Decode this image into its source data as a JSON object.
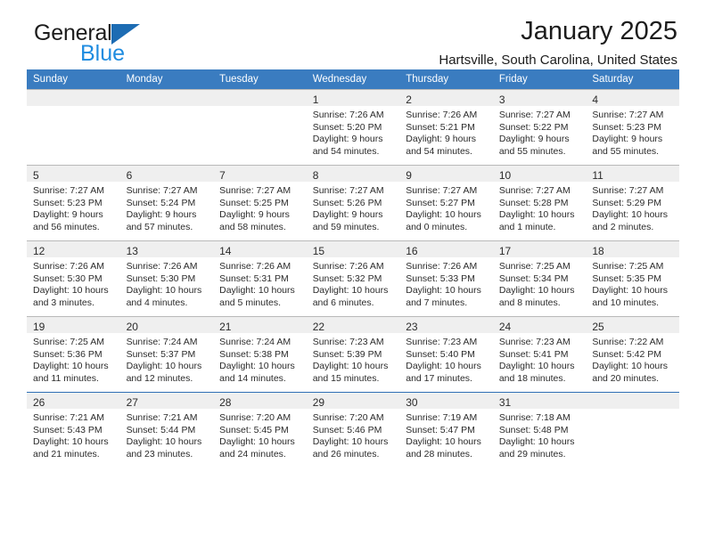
{
  "brand": {
    "name_top": "General",
    "name_bottom": "Blue",
    "accent_color": "#1f8ce0",
    "triangle_color": "#1d6cb3"
  },
  "header": {
    "title": "January 2025",
    "subtitle": "Hartsville, South Carolina, United States"
  },
  "calendar": {
    "header_bg": "#3a7cc0",
    "daynum_bg": "#efefef",
    "weekday_headers": [
      "Sunday",
      "Monday",
      "Tuesday",
      "Wednesday",
      "Thursday",
      "Friday",
      "Saturday"
    ],
    "weeks": [
      [
        {
          "day": "",
          "lines": []
        },
        {
          "day": "",
          "lines": []
        },
        {
          "day": "",
          "lines": []
        },
        {
          "day": "1",
          "lines": [
            "Sunrise: 7:26 AM",
            "Sunset: 5:20 PM",
            "Daylight: 9 hours",
            "and 54 minutes."
          ]
        },
        {
          "day": "2",
          "lines": [
            "Sunrise: 7:26 AM",
            "Sunset: 5:21 PM",
            "Daylight: 9 hours",
            "and 54 minutes."
          ]
        },
        {
          "day": "3",
          "lines": [
            "Sunrise: 7:27 AM",
            "Sunset: 5:22 PM",
            "Daylight: 9 hours",
            "and 55 minutes."
          ]
        },
        {
          "day": "4",
          "lines": [
            "Sunrise: 7:27 AM",
            "Sunset: 5:23 PM",
            "Daylight: 9 hours",
            "and 55 minutes."
          ]
        }
      ],
      [
        {
          "day": "5",
          "lines": [
            "Sunrise: 7:27 AM",
            "Sunset: 5:23 PM",
            "Daylight: 9 hours",
            "and 56 minutes."
          ]
        },
        {
          "day": "6",
          "lines": [
            "Sunrise: 7:27 AM",
            "Sunset: 5:24 PM",
            "Daylight: 9 hours",
            "and 57 minutes."
          ]
        },
        {
          "day": "7",
          "lines": [
            "Sunrise: 7:27 AM",
            "Sunset: 5:25 PM",
            "Daylight: 9 hours",
            "and 58 minutes."
          ]
        },
        {
          "day": "8",
          "lines": [
            "Sunrise: 7:27 AM",
            "Sunset: 5:26 PM",
            "Daylight: 9 hours",
            "and 59 minutes."
          ]
        },
        {
          "day": "9",
          "lines": [
            "Sunrise: 7:27 AM",
            "Sunset: 5:27 PM",
            "Daylight: 10 hours",
            "and 0 minutes."
          ]
        },
        {
          "day": "10",
          "lines": [
            "Sunrise: 7:27 AM",
            "Sunset: 5:28 PM",
            "Daylight: 10 hours",
            "and 1 minute."
          ]
        },
        {
          "day": "11",
          "lines": [
            "Sunrise: 7:27 AM",
            "Sunset: 5:29 PM",
            "Daylight: 10 hours",
            "and 2 minutes."
          ]
        }
      ],
      [
        {
          "day": "12",
          "lines": [
            "Sunrise: 7:26 AM",
            "Sunset: 5:30 PM",
            "Daylight: 10 hours",
            "and 3 minutes."
          ]
        },
        {
          "day": "13",
          "lines": [
            "Sunrise: 7:26 AM",
            "Sunset: 5:30 PM",
            "Daylight: 10 hours",
            "and 4 minutes."
          ]
        },
        {
          "day": "14",
          "lines": [
            "Sunrise: 7:26 AM",
            "Sunset: 5:31 PM",
            "Daylight: 10 hours",
            "and 5 minutes."
          ]
        },
        {
          "day": "15",
          "lines": [
            "Sunrise: 7:26 AM",
            "Sunset: 5:32 PM",
            "Daylight: 10 hours",
            "and 6 minutes."
          ]
        },
        {
          "day": "16",
          "lines": [
            "Sunrise: 7:26 AM",
            "Sunset: 5:33 PM",
            "Daylight: 10 hours",
            "and 7 minutes."
          ]
        },
        {
          "day": "17",
          "lines": [
            "Sunrise: 7:25 AM",
            "Sunset: 5:34 PM",
            "Daylight: 10 hours",
            "and 8 minutes."
          ]
        },
        {
          "day": "18",
          "lines": [
            "Sunrise: 7:25 AM",
            "Sunset: 5:35 PM",
            "Daylight: 10 hours",
            "and 10 minutes."
          ]
        }
      ],
      [
        {
          "day": "19",
          "lines": [
            "Sunrise: 7:25 AM",
            "Sunset: 5:36 PM",
            "Daylight: 10 hours",
            "and 11 minutes."
          ]
        },
        {
          "day": "20",
          "lines": [
            "Sunrise: 7:24 AM",
            "Sunset: 5:37 PM",
            "Daylight: 10 hours",
            "and 12 minutes."
          ]
        },
        {
          "day": "21",
          "lines": [
            "Sunrise: 7:24 AM",
            "Sunset: 5:38 PM",
            "Daylight: 10 hours",
            "and 14 minutes."
          ]
        },
        {
          "day": "22",
          "lines": [
            "Sunrise: 7:23 AM",
            "Sunset: 5:39 PM",
            "Daylight: 10 hours",
            "and 15 minutes."
          ]
        },
        {
          "day": "23",
          "lines": [
            "Sunrise: 7:23 AM",
            "Sunset: 5:40 PM",
            "Daylight: 10 hours",
            "and 17 minutes."
          ]
        },
        {
          "day": "24",
          "lines": [
            "Sunrise: 7:23 AM",
            "Sunset: 5:41 PM",
            "Daylight: 10 hours",
            "and 18 minutes."
          ]
        },
        {
          "day": "25",
          "lines": [
            "Sunrise: 7:22 AM",
            "Sunset: 5:42 PM",
            "Daylight: 10 hours",
            "and 20 minutes."
          ]
        }
      ],
      [
        {
          "day": "26",
          "lines": [
            "Sunrise: 7:21 AM",
            "Sunset: 5:43 PM",
            "Daylight: 10 hours",
            "and 21 minutes."
          ]
        },
        {
          "day": "27",
          "lines": [
            "Sunrise: 7:21 AM",
            "Sunset: 5:44 PM",
            "Daylight: 10 hours",
            "and 23 minutes."
          ]
        },
        {
          "day": "28",
          "lines": [
            "Sunrise: 7:20 AM",
            "Sunset: 5:45 PM",
            "Daylight: 10 hours",
            "and 24 minutes."
          ]
        },
        {
          "day": "29",
          "lines": [
            "Sunrise: 7:20 AM",
            "Sunset: 5:46 PM",
            "Daylight: 10 hours",
            "and 26 minutes."
          ]
        },
        {
          "day": "30",
          "lines": [
            "Sunrise: 7:19 AM",
            "Sunset: 5:47 PM",
            "Daylight: 10 hours",
            "and 28 minutes."
          ]
        },
        {
          "day": "31",
          "lines": [
            "Sunrise: 7:18 AM",
            "Sunset: 5:48 PM",
            "Daylight: 10 hours",
            "and 29 minutes."
          ]
        },
        {
          "day": "",
          "lines": []
        }
      ]
    ]
  }
}
